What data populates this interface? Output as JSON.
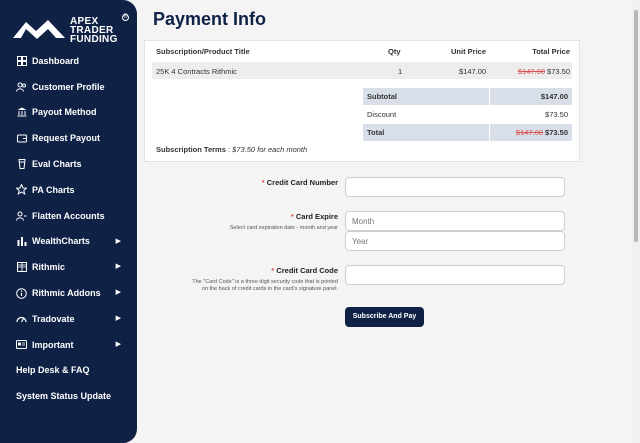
{
  "brand": {
    "line1": "APEX",
    "line2": "TRADER",
    "line3": "FUNDING",
    "reg_mark": "®"
  },
  "sidebar": {
    "items": [
      {
        "label": "Dashboard",
        "icon": "dashboard-icon",
        "has_children": false
      },
      {
        "label": "Customer Profile",
        "icon": "users-icon",
        "has_children": false
      },
      {
        "label": "Payout Method",
        "icon": "bank-icon",
        "has_children": false
      },
      {
        "label": "Request Payout",
        "icon": "wallet-icon",
        "has_children": false
      },
      {
        "label": "Eval Charts",
        "icon": "cup-icon",
        "has_children": false
      },
      {
        "label": "PA Charts",
        "icon": "star-icon",
        "has_children": false
      },
      {
        "label": "Flatten Accounts",
        "icon": "user-minus-icon",
        "has_children": false
      },
      {
        "label": "WealthCharts",
        "icon": "bar-chart-icon",
        "has_children": true
      },
      {
        "label": "Rithmic",
        "icon": "grid-icon",
        "has_children": true
      },
      {
        "label": "Rithmic Addons",
        "icon": "info-circle-icon",
        "has_children": true
      },
      {
        "label": "Tradovate",
        "icon": "gauge-icon",
        "has_children": true
      },
      {
        "label": "Important",
        "icon": "id-card-icon",
        "has_children": true
      }
    ],
    "links": [
      {
        "label": "Help Desk & FAQ"
      },
      {
        "label": "System Status Update"
      }
    ]
  },
  "page": {
    "title": "Payment Info"
  },
  "order": {
    "headers": {
      "product": "Subscription/Product Title",
      "qty": "Qty",
      "unit_price": "Unit Price",
      "total_price": "Total Price"
    },
    "row": {
      "product": "25K 4 Contracts Rithmic",
      "qty": "1",
      "unit_price": "$147.00",
      "old_total": "$147.00",
      "total": "$73.50"
    },
    "subtotal": {
      "label": "Subtotal",
      "value": "$147.00"
    },
    "discount": {
      "label": "Discount",
      "value": "$73.50"
    },
    "total": {
      "label": "Total",
      "old_value": "$147.00",
      "value": "$73.50"
    },
    "terms": {
      "label": "Subscription Terms",
      "separator": " : ",
      "value": "$73.50 for each month"
    }
  },
  "form": {
    "required_mark": "*",
    "card_number": {
      "label": "Credit Card Number",
      "value": ""
    },
    "expire": {
      "label": "Card Expire",
      "help": "Select card expiration date - month and year",
      "month_placeholder": "Month",
      "year_placeholder": "Year"
    },
    "card_code": {
      "label": "Credit Card Code",
      "help_line1": "The \"Card Code\" is a three digit security code that is printed",
      "help_line2": "on the back of credit cards in the card's signature panel.",
      "value": ""
    },
    "submit_label": "Subscribe And Pay"
  },
  "colors": {
    "navy": "#0f2246",
    "strike_red": "#d9534f",
    "summary_shade": "#d9dfe8"
  }
}
